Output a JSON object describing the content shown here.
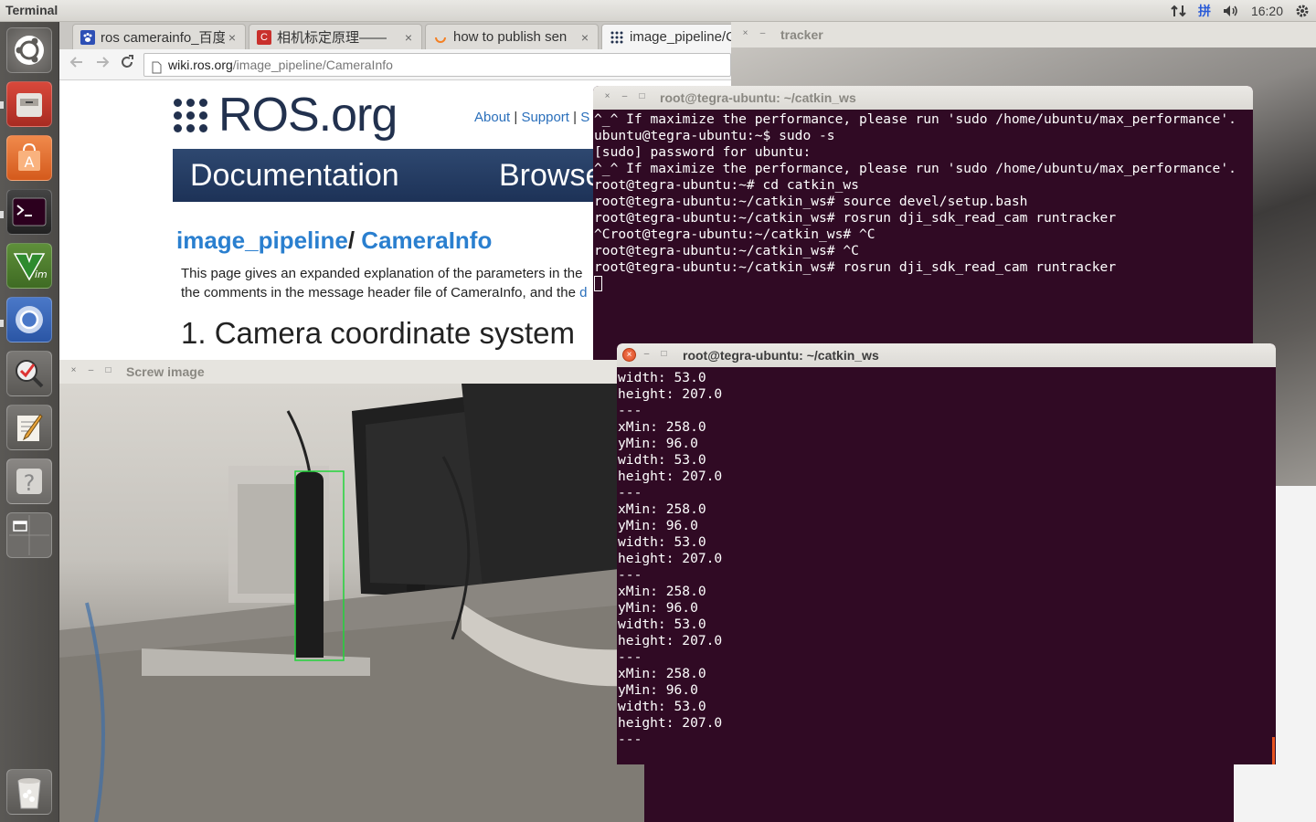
{
  "top_panel": {
    "app_title": "Terminal",
    "indicators": {
      "network_icon": "updown-arrows-icon",
      "input_method": "拼",
      "volume_icon": "speaker-icon",
      "clock": "16:20",
      "settings_icon": "gear-icon"
    }
  },
  "launcher": {
    "items": [
      {
        "name": "dash-home",
        "icon": "ubuntu-logo-icon"
      },
      {
        "name": "files",
        "icon": "file-cabinet-icon"
      },
      {
        "name": "software-center",
        "icon": "shopping-bag-icon"
      },
      {
        "name": "terminal",
        "icon": "terminal-icon"
      },
      {
        "name": "vim",
        "icon": "vim-icon"
      },
      {
        "name": "chromium",
        "icon": "chromium-icon"
      },
      {
        "name": "search-app",
        "icon": "magnifier-check-icon"
      },
      {
        "name": "text-editor",
        "icon": "notepad-pencil-icon"
      },
      {
        "name": "help",
        "icon": "question-mark-icon"
      },
      {
        "name": "workspaces",
        "icon": "workspace-switcher-icon"
      },
      {
        "name": "trash",
        "icon": "trash-icon"
      }
    ]
  },
  "browser": {
    "tabs": [
      {
        "label": "ros camerainfo_百度",
        "favicon_color": "#2d4fb5"
      },
      {
        "label": "相机标定原理——",
        "favicon_color": "#c9302c"
      },
      {
        "label": "how to publish sen",
        "favicon_color": "#f48024"
      },
      {
        "label": "image_pipeline/Ca",
        "favicon_color": "#22314e"
      }
    ],
    "tab_close_glyph": "×",
    "url_host": "wiki.ros.org",
    "url_path": "/image_pipeline/CameraInfo",
    "page": {
      "logo_text": "ROS.org",
      "top_links": {
        "about": "About",
        "support": "Support",
        "sep": " | ",
        "truncated": "S"
      },
      "nav_documentation": "Documentation",
      "nav_browse": "Browse",
      "title_part1": "image_pipeline",
      "title_sep": "/ ",
      "title_part2": "CameraInfo",
      "intro_line1": "This page gives an expanded explanation of the parameters in the",
      "intro_line2": "the comments in the message header file of CameraInfo, and the",
      "intro_line2_link": "d",
      "section_heading": "1. Camera coordinate system"
    }
  },
  "tracker_window": {
    "title": "tracker"
  },
  "screw_window": {
    "title": "Screw image",
    "bbox_color": "#22d43a"
  },
  "terminal_back": {
    "title": "root@tegra-ubuntu: ~/catkin_ws",
    "lines": [
      "^_^ If maximize the performance, please run 'sudo /home/ubuntu/max_performance'.",
      "ubuntu@tegra-ubuntu:~$ sudo -s",
      "[sudo] password for ubuntu:",
      "^_^ If maximize the performance, please run 'sudo /home/ubuntu/max_performance'.",
      "root@tegra-ubuntu:~# cd catkin_ws",
      "root@tegra-ubuntu:~/catkin_ws# source devel/setup.bash",
      "root@tegra-ubuntu:~/catkin_ws# rosrun dji_sdk_read_cam runtracker",
      "^Croot@tegra-ubuntu:~/catkin_ws# ^C",
      "root@tegra-ubuntu:~/catkin_ws# ^C",
      "root@tegra-ubuntu:~/catkin_ws# rosrun dji_sdk_read_cam runtracker"
    ]
  },
  "terminal_front": {
    "title": "root@tegra-ubuntu: ~/catkin_ws",
    "lines": [
      "width: 53.0",
      "height: 207.0",
      "---",
      "xMin: 258.0",
      "yMin: 96.0",
      "width: 53.0",
      "height: 207.0",
      "---",
      "xMin: 258.0",
      "yMin: 96.0",
      "width: 53.0",
      "height: 207.0",
      "---",
      "xMin: 258.0",
      "yMin: 96.0",
      "width: 53.0",
      "height: 207.0",
      "---",
      "xMin: 258.0",
      "yMin: 96.0",
      "width: 53.0",
      "height: 207.0",
      "---"
    ]
  },
  "window_button_glyphs": {
    "close": "×",
    "minimize": "–",
    "maximize": "□"
  }
}
